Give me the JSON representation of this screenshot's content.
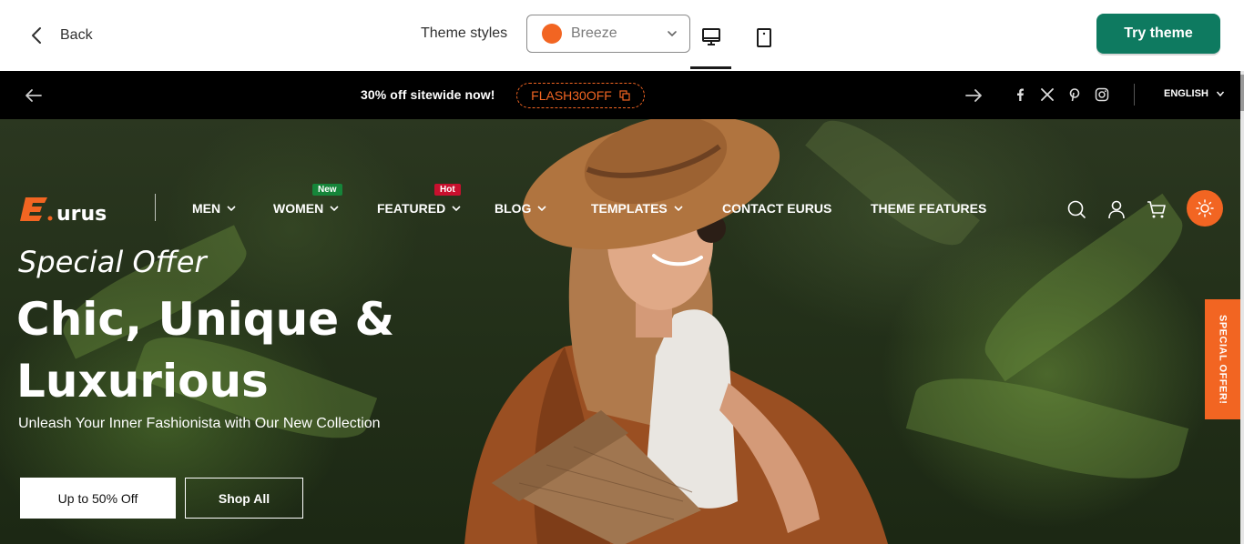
{
  "editor": {
    "back_label": "Back",
    "theme_styles_label": "Theme styles",
    "style_select": {
      "value": "Breeze",
      "swatch_color": "#f26522"
    },
    "try_theme_label": "Try theme",
    "try_theme_color": "#0e7a60",
    "devices": [
      "desktop-icon",
      "mobile-icon"
    ],
    "active_device": "desktop"
  },
  "store": {
    "accent_color": "#f26522",
    "announcement": {
      "message": "30% off sitewide now!",
      "coupon_code": "FLASH30OFF",
      "social": [
        "facebook-icon",
        "x-twitter-icon",
        "pinterest-icon",
        "instagram-icon"
      ],
      "language": "ENGLISH"
    },
    "header": {
      "logo_text": "Eurus",
      "nav": [
        {
          "label": "MEN",
          "has_dropdown": true
        },
        {
          "label": "WOMEN",
          "has_dropdown": true,
          "badge": "New"
        },
        {
          "label": "FEATURED",
          "has_dropdown": true,
          "badge": "Hot"
        },
        {
          "label": "BLOG",
          "has_dropdown": true
        },
        {
          "label": "TEMPLATES",
          "has_dropdown": true
        },
        {
          "label": "CONTACT EURUS",
          "has_dropdown": false
        },
        {
          "label": "THEME FEATURES",
          "has_dropdown": false
        }
      ],
      "icons": [
        "search-icon",
        "account-icon",
        "cart-icon",
        "theme-toggle-sun-icon"
      ]
    },
    "hero": {
      "subtitle": "Special Offer",
      "title": "Chic, Unique & Luxurious",
      "description": "Unleash Your Inner Fashionista with Our New Collection",
      "primary_button": "Up to 50% Off",
      "secondary_button": "Shop All"
    },
    "side_tab": "SPECIAL OFFER!"
  }
}
